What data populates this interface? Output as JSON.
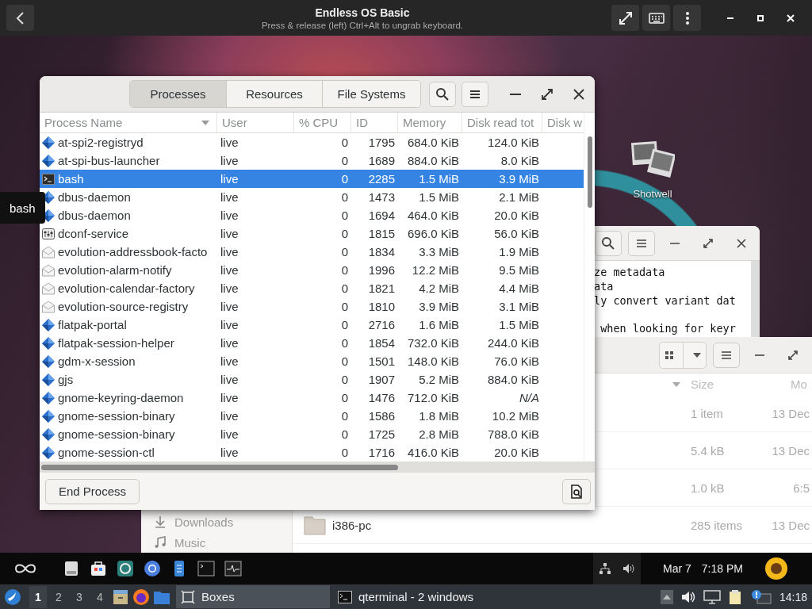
{
  "vm_bar": {
    "title": "Endless OS Basic",
    "subtitle": "Press & release (left) Ctrl+Alt to ungrab keyboard."
  },
  "desktop_icons": [
    {
      "label": "Shotwell"
    }
  ],
  "tooltip": {
    "text": "bash"
  },
  "terminal_window": {
    "lines": [
      {
        "text": "ze metadata"
      },
      {
        "text": "ata"
      },
      {
        "text": "ly convert variant dat"
      },
      {
        "text": " when looking for keyr"
      }
    ]
  },
  "files_window": {
    "sidebar": [
      {
        "label": "Downloads"
      },
      {
        "label": "Music"
      }
    ],
    "columns": [
      "Size",
      "Mo"
    ],
    "rows": [
      {
        "size": "1 item",
        "modified": "13 Dec"
      },
      {
        "size": "5.4 kB",
        "modified": "13 Dec"
      },
      {
        "size": "1.0 kB",
        "modified": "6:5"
      },
      {
        "name": "i386-pc",
        "size": "285 items",
        "modified": "13 Dec"
      }
    ]
  },
  "system_monitor": {
    "tabs": [
      {
        "label": "Processes",
        "selected": true
      },
      {
        "label": "Resources",
        "selected": false
      },
      {
        "label": "File Systems",
        "selected": false
      }
    ],
    "columns": [
      "Process Name",
      "User",
      "% CPU",
      "ID",
      "Memory",
      "Disk read tot",
      "Disk w"
    ],
    "rows": [
      {
        "kind": "generic",
        "name": "at-spi2-registryd",
        "user": "live",
        "cpu": "0",
        "id": "1795",
        "memory": "684.0 KiB",
        "disk_read": "124.0 KiB",
        "selected": false
      },
      {
        "kind": "generic",
        "name": "at-spi-bus-launcher",
        "user": "live",
        "cpu": "0",
        "id": "1689",
        "memory": "884.0 KiB",
        "disk_read": "8.0 KiB",
        "selected": false
      },
      {
        "kind": "terminal",
        "name": "bash",
        "user": "live",
        "cpu": "0",
        "id": "2285",
        "memory": "1.5 MiB",
        "disk_read": "3.9 MiB",
        "selected": true
      },
      {
        "kind": "generic",
        "name": "dbus-daemon",
        "user": "live",
        "cpu": "0",
        "id": "1473",
        "memory": "1.5 MiB",
        "disk_read": "2.1 MiB",
        "selected": false
      },
      {
        "kind": "generic",
        "name": "dbus-daemon",
        "user": "live",
        "cpu": "0",
        "id": "1694",
        "memory": "464.0 KiB",
        "disk_read": "20.0 KiB",
        "selected": false
      },
      {
        "kind": "settings",
        "name": "dconf-service",
        "user": "live",
        "cpu": "0",
        "id": "1815",
        "memory": "696.0 KiB",
        "disk_read": "56.0 KiB",
        "selected": false
      },
      {
        "kind": "mail",
        "name": "evolution-addressbook-facto",
        "user": "live",
        "cpu": "0",
        "id": "1834",
        "memory": "3.3 MiB",
        "disk_read": "1.9 MiB",
        "selected": false
      },
      {
        "kind": "mail",
        "name": "evolution-alarm-notify",
        "user": "live",
        "cpu": "0",
        "id": "1996",
        "memory": "12.2 MiB",
        "disk_read": "9.5 MiB",
        "selected": false
      },
      {
        "kind": "mail",
        "name": "evolution-calendar-factory",
        "user": "live",
        "cpu": "0",
        "id": "1821",
        "memory": "4.2 MiB",
        "disk_read": "4.4 MiB",
        "selected": false
      },
      {
        "kind": "mail",
        "name": "evolution-source-registry",
        "user": "live",
        "cpu": "0",
        "id": "1810",
        "memory": "3.9 MiB",
        "disk_read": "3.1 MiB",
        "selected": false
      },
      {
        "kind": "generic",
        "name": "flatpak-portal",
        "user": "live",
        "cpu": "0",
        "id": "2716",
        "memory": "1.6 MiB",
        "disk_read": "1.5 MiB",
        "selected": false
      },
      {
        "kind": "generic",
        "name": "flatpak-session-helper",
        "user": "live",
        "cpu": "0",
        "id": "1854",
        "memory": "732.0 KiB",
        "disk_read": "244.0 KiB",
        "selected": false
      },
      {
        "kind": "generic",
        "name": "gdm-x-session",
        "user": "live",
        "cpu": "0",
        "id": "1501",
        "memory": "148.0 KiB",
        "disk_read": "76.0 KiB",
        "selected": false
      },
      {
        "kind": "generic",
        "name": "gjs",
        "user": "live",
        "cpu": "0",
        "id": "1907",
        "memory": "5.2 MiB",
        "disk_read": "884.0 KiB",
        "selected": false
      },
      {
        "kind": "generic",
        "name": "gnome-keyring-daemon",
        "user": "live",
        "cpu": "0",
        "id": "1476",
        "memory": "712.0 KiB",
        "disk_read": "N/A",
        "disk_read_unavailable": true,
        "selected": false
      },
      {
        "kind": "generic",
        "name": "gnome-session-binary",
        "user": "live",
        "cpu": "0",
        "id": "1586",
        "memory": "1.8 MiB",
        "disk_read": "10.2 MiB",
        "selected": false
      },
      {
        "kind": "generic",
        "name": "gnome-session-binary",
        "user": "live",
        "cpu": "0",
        "id": "1725",
        "memory": "2.8 MiB",
        "disk_read": "788.0 KiB",
        "selected": false
      },
      {
        "kind": "generic",
        "name": "gnome-session-ctl",
        "user": "live",
        "cpu": "0",
        "id": "1716",
        "memory": "416.0 KiB",
        "disk_read": "20.0 KiB",
        "selected": false
      }
    ],
    "end_button": "End Process"
  },
  "dock": {
    "date": "Mar 7",
    "time": "7:18 PM"
  },
  "taskbar": {
    "workspaces": [
      {
        "label": "1",
        "selected": true
      },
      {
        "label": "2",
        "selected": false
      },
      {
        "label": "3",
        "selected": false
      },
      {
        "label": "4",
        "selected": false
      }
    ],
    "tasks": [
      {
        "label": "Boxes",
        "kind": "boxes",
        "selected": true
      },
      {
        "label": "qterminal - 2 windows",
        "kind": "terminal",
        "selected": false
      }
    ],
    "clock": "14:18"
  }
}
